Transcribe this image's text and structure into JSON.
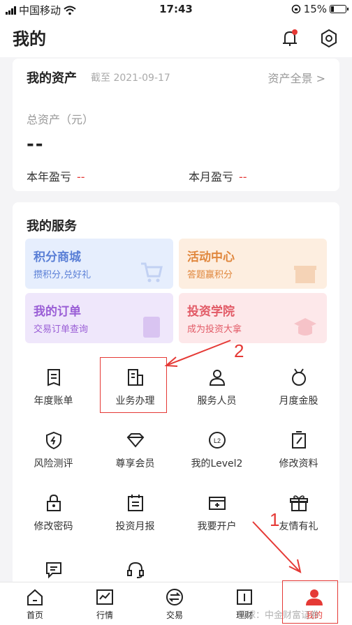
{
  "status": {
    "carrier": "中国移动",
    "time": "17:43",
    "battery": "15%"
  },
  "header": {
    "title": "我的"
  },
  "assets": {
    "title": "我的资产",
    "date": "截至 2021-09-17",
    "overview": "资产全景 >",
    "total_label": "总资产（元）",
    "total_value": "--",
    "year_label": "本年盈亏",
    "year_value": "--",
    "month_label": "本月盈亏",
    "month_value": "--"
  },
  "services": {
    "title": "我的服务",
    "tiles": [
      {
        "title": "积分商城",
        "sub": "攒积分,兑好礼"
      },
      {
        "title": "活动中心",
        "sub": "答题赢积分"
      },
      {
        "title": "我的订单",
        "sub": "交易订单查询"
      },
      {
        "title": "投资学院",
        "sub": "成为投资大拿"
      }
    ],
    "grid": [
      "年度账单",
      "业务办理",
      "服务人员",
      "月度金股",
      "风险测评",
      "尊享会员",
      "我的Level2",
      "修改资料",
      "修改密码",
      "投资月报",
      "我要开户",
      "友情有礼"
    ]
  },
  "tabbar": [
    "首页",
    "行情",
    "交易",
    "理财",
    "我的"
  ],
  "annotations": [
    "1",
    "2"
  ],
  "watermark": "雪球：中金财富证券",
  "colors": {
    "accent": "#e53935",
    "shop": "#5a7fd6",
    "activity": "#e0873d",
    "orders": "#9a5ed6",
    "academy": "#e25a66"
  }
}
